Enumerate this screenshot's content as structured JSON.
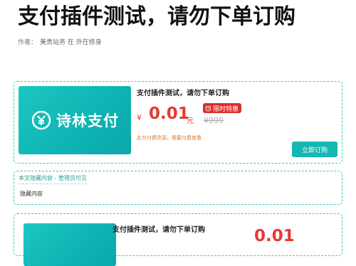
{
  "page": {
    "title": "支付插件测试，请勿下单订购",
    "author_label": "作者：",
    "author_name": "美贵站务 在 外在修身"
  },
  "product_cards": [
    {
      "title": "支付插件测试，请勿下单订购",
      "brand": "诗林支付",
      "currency": "¥",
      "price": "0.01",
      "unit": "元",
      "promo_badge": "限时特惠",
      "original_price": "¥999",
      "note": "此为付费资源，需要付费查看",
      "buy_label": "立即订购"
    },
    {
      "title": "支付插件测试，请勿下单订购",
      "price": "0.01"
    }
  ],
  "hidden_section": {
    "tag": "本文隐藏内容 - 管理员可见",
    "content": "隐藏内容"
  },
  "colors": {
    "accent": "#15b7b4",
    "price_red": "#e53935",
    "note_orange": "#e07a2f"
  },
  "icons": {
    "brand_logo": "yen-circle-icon",
    "promo": "alarm-clock-icon"
  }
}
